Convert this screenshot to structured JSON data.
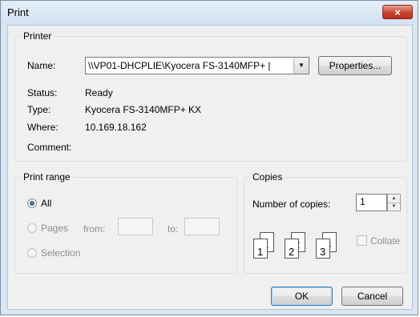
{
  "window": {
    "title": "Print",
    "close_glyph": "×"
  },
  "printer": {
    "group_label": "Printer",
    "name_label": "Name:",
    "name_value": "\\\\VP01-DHCPLIE\\Kyocera FS-3140MFP+ |",
    "properties_label": "Properties...",
    "status_label": "Status:",
    "status_value": "Ready",
    "type_label": "Type:",
    "type_value": "Kyocera FS-3140MFP+ KX",
    "where_label": "Where:",
    "where_value": "10.169.18.162",
    "comment_label": "Comment:"
  },
  "print_range": {
    "group_label": "Print range",
    "all_label": "All",
    "pages_label": "Pages",
    "from_label": "from:",
    "to_label": "to:",
    "selection_label": "Selection"
  },
  "copies": {
    "group_label": "Copies",
    "number_label": "Number of copies:",
    "number_value": "1",
    "collate_label": "Collate",
    "page_labels": [
      "1",
      "1",
      "2",
      "2",
      "3",
      "3"
    ]
  },
  "buttons": {
    "ok": "OK",
    "cancel": "Cancel"
  }
}
